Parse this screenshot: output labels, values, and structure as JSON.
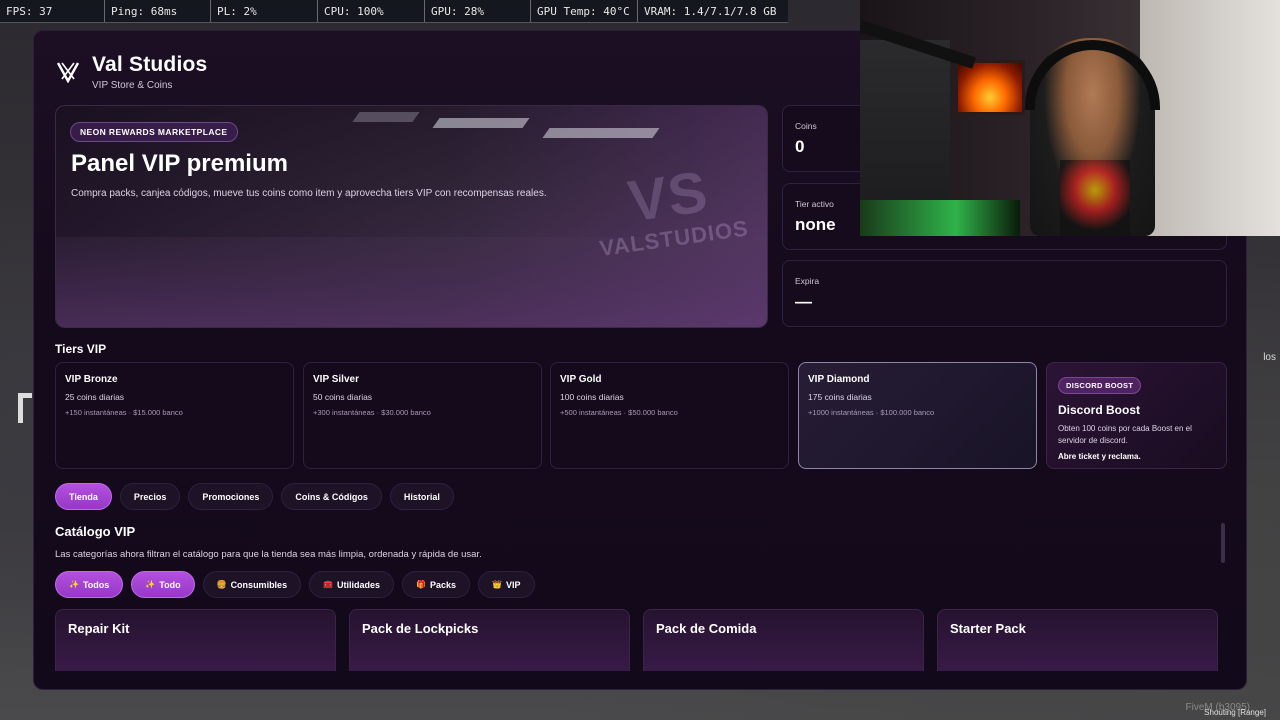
{
  "perf": {
    "fps": "FPS: 37",
    "ping": "Ping: 68ms",
    "pl": "PL: 2%",
    "cpu": "CPU: 100%",
    "gpu": "GPU: 28%",
    "gpu_temp": "GPU Temp: 40°C",
    "vram": "VRAM: 1.4/7.1/7.8 GB"
  },
  "brand": {
    "title": "Val Studios",
    "subtitle": "VIP Store & Coins"
  },
  "hero": {
    "badge": "NEON REWARDS MARKETPLACE",
    "title": "Panel VIP premium",
    "description": "Compra packs, canjea códigos, mueve tus coins como item y aprovecha tiers VIP con recompensas reales.",
    "watermark": "VALSTUDIOS"
  },
  "stats": {
    "coins_label": "Coins",
    "coins_value": "0",
    "tier_label": "Tier activo",
    "tier_value": "none",
    "expira_label": "Expira",
    "expira_value": "—"
  },
  "tiers_title": "Tiers VIP",
  "tiers": [
    {
      "name": "VIP Bronze",
      "daily": "25 coins diarias",
      "extra": "+150 instantáneas · $15.000 banco"
    },
    {
      "name": "VIP Silver",
      "daily": "50 coins diarias",
      "extra": "+300 instantáneas · $30.000 banco"
    },
    {
      "name": "VIP Gold",
      "daily": "100 coins diarias",
      "extra": "+500 instantáneas · $50.000 banco"
    },
    {
      "name": "VIP Diamond",
      "daily": "175 coins diarias",
      "extra": "+1000 instantáneas · $100.000 banco"
    }
  ],
  "discord": {
    "badge": "DISCORD BOOST",
    "title": "Discord Boost",
    "description": "Obten 100 coins por cada Boost en el servidor de discord.",
    "link": "Abre ticket y reclama."
  },
  "tabs": [
    "Tienda",
    "Precios",
    "Promociones",
    "Coins & Códigos",
    "Historial"
  ],
  "catalog": {
    "title": "Catálogo VIP",
    "subtitle": "Las categorías ahora filtran el catálogo para que la tienda sea más limpia, ordenada y rápida de usar.",
    "filters": [
      {
        "icon": "✨",
        "label": "Todos"
      },
      {
        "icon": "✨",
        "label": "Todo"
      },
      {
        "icon": "🍔",
        "label": "Consumibles"
      },
      {
        "icon": "🧰",
        "label": "Utilidades"
      },
      {
        "icon": "🎁",
        "label": "Packs"
      },
      {
        "icon": "👑",
        "label": "VIP"
      }
    ],
    "products": [
      "Repair Kit",
      "Pack de Lockpicks",
      "Pack de Comida",
      "Starter Pack"
    ]
  },
  "footer": {
    "fivem": "FiveM (b3095)",
    "status": "Shouting [Range]"
  },
  "hud_right": "los",
  "colors": {
    "accent": "#a844d6",
    "panel_bg": "#150a1c"
  }
}
